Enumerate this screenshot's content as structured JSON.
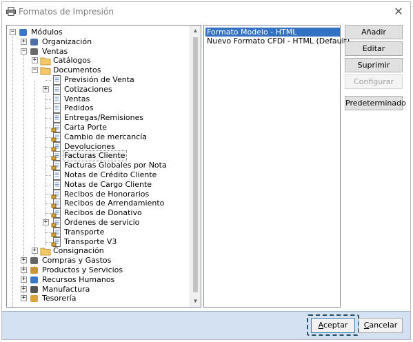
{
  "window": {
    "title": "Formatos de Impresión",
    "close_symbol": "✕"
  },
  "tree": [
    {
      "label": "Módulos",
      "level": 0,
      "expander": "-",
      "icon": "modules-icon"
    },
    {
      "label": "Organización",
      "level": 1,
      "expander": "+",
      "icon": "building-icon"
    },
    {
      "label": "Ventas",
      "level": 1,
      "expander": "-",
      "icon": "users-icon"
    },
    {
      "label": "Catálogos",
      "level": 2,
      "expander": "+",
      "icon": "folder-icon"
    },
    {
      "label": "Documentos",
      "level": 2,
      "expander": "-",
      "icon": "folder-open-icon"
    },
    {
      "label": "Previsión de Venta",
      "level": 3,
      "expander": "",
      "icon": "document-icon"
    },
    {
      "label": "Cotizaciones",
      "level": 3,
      "expander": "+",
      "icon": "document-icon"
    },
    {
      "label": "Ventas",
      "level": 3,
      "expander": "",
      "icon": "document-icon"
    },
    {
      "label": "Pedidos",
      "level": 3,
      "expander": "",
      "icon": "document-icon"
    },
    {
      "label": "Entregas/Remisiones",
      "level": 3,
      "expander": "",
      "icon": "document-icon"
    },
    {
      "label": "Carta Porte",
      "level": 3,
      "expander": "",
      "icon": "truck-document-icon"
    },
    {
      "label": "Cambio de mercancía",
      "level": 3,
      "expander": "",
      "icon": "exchange-document-icon"
    },
    {
      "label": "Devoluciones",
      "level": 3,
      "expander": "",
      "icon": "return-document-icon"
    },
    {
      "label": "Facturas Cliente",
      "level": 3,
      "expander": "",
      "icon": "invoice-document-icon",
      "selected": true
    },
    {
      "label": "Facturas Globales por Nota",
      "level": 3,
      "expander": "",
      "icon": "invoice-document-icon"
    },
    {
      "label": "Notas de Crédito Cliente",
      "level": 3,
      "expander": "",
      "icon": "document-icon"
    },
    {
      "label": "Notas de Cargo Cliente",
      "level": 3,
      "expander": "",
      "icon": "document-icon"
    },
    {
      "label": "Recibos de Honorarios",
      "level": 3,
      "expander": "",
      "icon": "receipt-document-icon"
    },
    {
      "label": "Recibos de Arrendamiento",
      "level": 3,
      "expander": "",
      "icon": "house-document-icon"
    },
    {
      "label": "Recibos de Donativo",
      "level": 3,
      "expander": "",
      "icon": "heart-document-icon"
    },
    {
      "label": "Órdenes de servicio",
      "level": 3,
      "expander": "+",
      "icon": "service-document-icon"
    },
    {
      "label": "Transporte",
      "level": 3,
      "expander": "",
      "icon": "truck-document-icon"
    },
    {
      "label": "Transporte V3",
      "level": 3,
      "expander": "",
      "icon": "truck-document-icon"
    },
    {
      "label": "Consignación",
      "level": 2,
      "expander": "+",
      "icon": "folder-icon"
    },
    {
      "label": "Compras y Gastos",
      "level": 1,
      "expander": "+",
      "icon": "cart-icon"
    },
    {
      "label": "Productos y Servicios",
      "level": 1,
      "expander": "+",
      "icon": "boxes-icon"
    },
    {
      "label": "Recursos Humanos",
      "level": 1,
      "expander": "+",
      "icon": "people-icon"
    },
    {
      "label": "Manufactura",
      "level": 1,
      "expander": "+",
      "icon": "factory-icon"
    },
    {
      "label": "Tesorería",
      "level": 1,
      "expander": "+",
      "icon": "money-icon"
    }
  ],
  "formats": [
    {
      "label": "Formato Modelo - HTML",
      "selected": true
    },
    {
      "label": "Nuevo Formato CFDI - HTML (Default)",
      "selected": false
    }
  ],
  "buttons": {
    "add": "Añadir",
    "edit": "Editar",
    "delete": "Suprimir",
    "configure": "Configurar",
    "default": "Predeterminado"
  },
  "footer": {
    "accept_hot": "A",
    "accept_rest": "ceptar",
    "cancel_hot": "C",
    "cancel_rest": "ancelar"
  },
  "colors": {
    "selection": "#3371c2",
    "footer_bg": "#d3e1f3",
    "accent_outline": "#1f4d5f"
  }
}
